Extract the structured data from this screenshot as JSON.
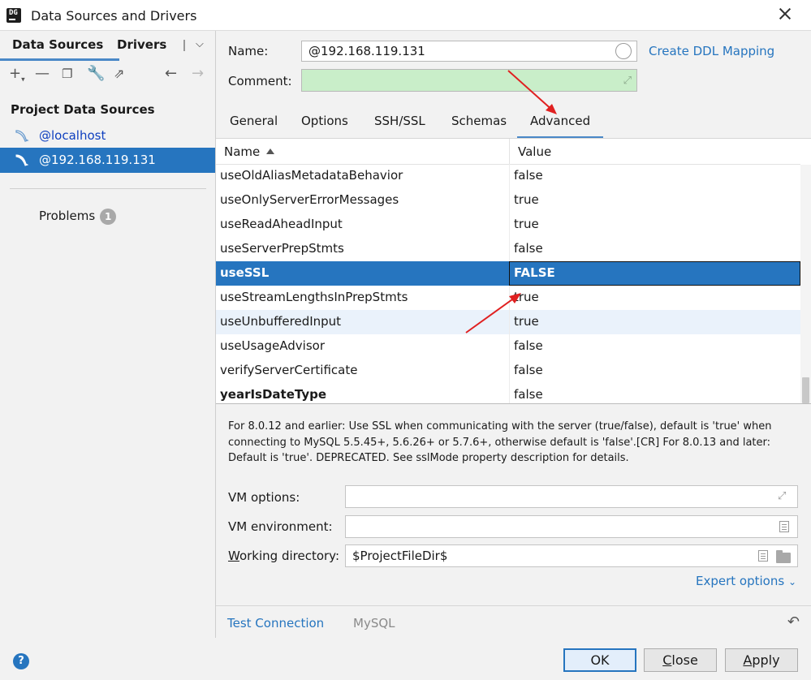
{
  "window": {
    "title": "Data Sources and Drivers"
  },
  "left": {
    "tabs": [
      "Data Sources",
      "Drivers"
    ],
    "section_title": "Project Data Sources",
    "sources": [
      "@localhost",
      "@192.168.119.131"
    ],
    "problems_label": "Problems",
    "problems_count": "1"
  },
  "form": {
    "name_label": "Name:",
    "name_value": "@192.168.119.131",
    "comment_label": "Comment:",
    "ddl_link": "Create DDL Mapping"
  },
  "tabs": [
    "General",
    "Options",
    "SSH/SSL",
    "Schemas",
    "Advanced"
  ],
  "table": {
    "col_name": "Name",
    "col_value": "Value",
    "rows": [
      {
        "name": "useOldAliasMetadataBehavior",
        "value": "false"
      },
      {
        "name": "useOnlyServerErrorMessages",
        "value": "true"
      },
      {
        "name": "useReadAheadInput",
        "value": "true"
      },
      {
        "name": "useServerPrepStmts",
        "value": "false"
      },
      {
        "name": "useSSL",
        "value": "FALSE"
      },
      {
        "name": "useStreamLengthsInPrepStmts",
        "value": "true"
      },
      {
        "name": "useUnbufferedInput",
        "value": "true"
      },
      {
        "name": "useUsageAdvisor",
        "value": "false"
      },
      {
        "name": "verifyServerCertificate",
        "value": "false"
      },
      {
        "name": "yearIsDateType",
        "value": "false"
      }
    ]
  },
  "description": "For 8.0.12 and earlier: Use SSL when communicating with the server (true/false), default is 'true' when connecting to MySQL 5.5.45+, 5.6.26+ or 5.7.6+, otherwise default is 'false'.[CR] For 8.0.13 and later: Default is 'true'. DEPRECATED. See sslMode property description for details.",
  "vm": {
    "options_label": "VM options:",
    "env_label": "VM environment:",
    "workdir_label_first": "W",
    "workdir_label_rest": "orking directory:",
    "workdir_value": "$ProjectFileDir$",
    "expert_label": "Expert options"
  },
  "bottom": {
    "test_connection": "Test Connection",
    "driver": "MySQL"
  },
  "buttons": {
    "ok": "OK",
    "close_first": "C",
    "close_rest": "lose",
    "apply_first": "A",
    "apply_rest": "pply"
  },
  "colors": {
    "accent": "#2675bf",
    "selection": "#2675bf",
    "comment_bg": "#c9eec9",
    "annotation_arrow": "#e02020"
  }
}
